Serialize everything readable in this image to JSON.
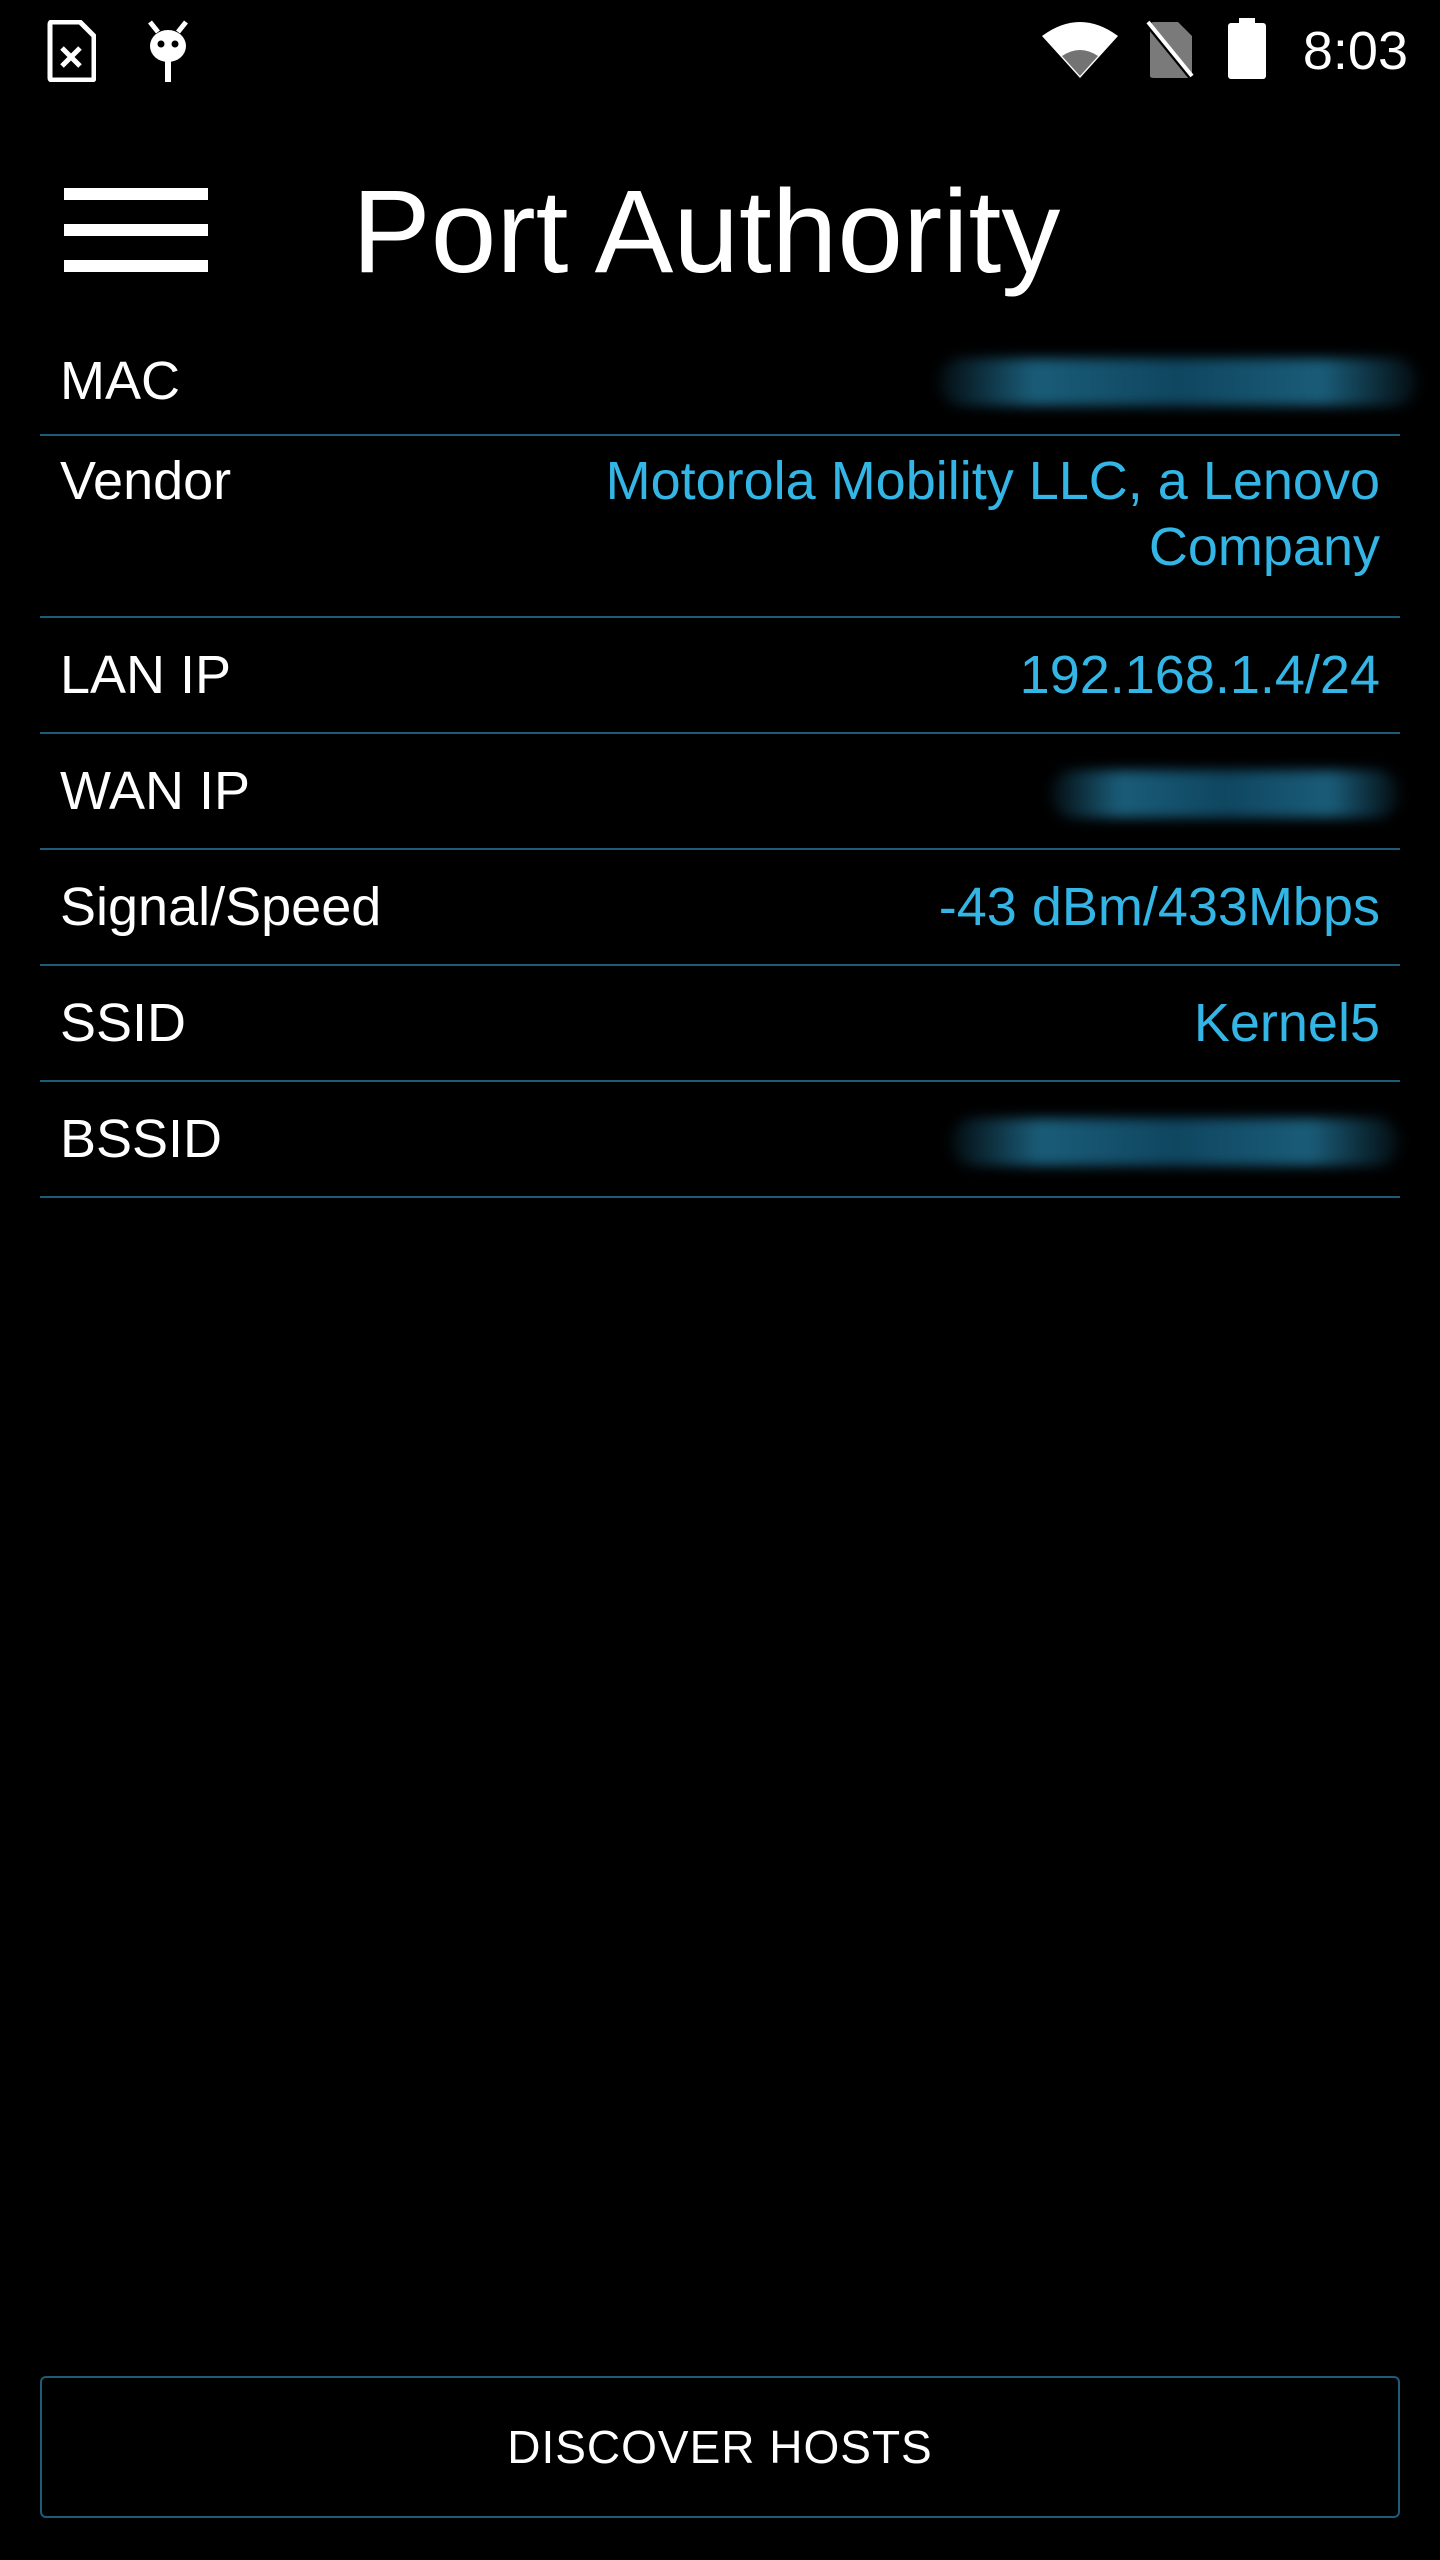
{
  "status_bar": {
    "time": "8:03",
    "icons": [
      "sim-error-icon",
      "debug-bug-icon",
      "wifi-icon",
      "no-sim-icon",
      "battery-icon"
    ]
  },
  "app_bar": {
    "title": "Port Authority",
    "menu_icon": "hamburger-menu-icon"
  },
  "network_info": {
    "mac": {
      "label": "MAC",
      "value": ""
    },
    "vendor": {
      "label": "Vendor",
      "value": "Motorola Mobility LLC, a Lenovo Company"
    },
    "lan_ip": {
      "label": "LAN IP",
      "value": "192.168.1.4/24"
    },
    "wan_ip": {
      "label": "WAN IP",
      "value": ""
    },
    "signal_speed": {
      "label": "Signal/Speed",
      "value": "-43 dBm/433Mbps"
    },
    "ssid": {
      "label": "SSID",
      "value": "Kernel5"
    },
    "bssid": {
      "label": "BSSID",
      "value": ""
    }
  },
  "actions": {
    "discover_hosts": "DISCOVER HOSTS"
  },
  "colors": {
    "background": "#000000",
    "accent": "#33b5e5",
    "divider": "#1e5a7a",
    "text": "#ffffff"
  }
}
